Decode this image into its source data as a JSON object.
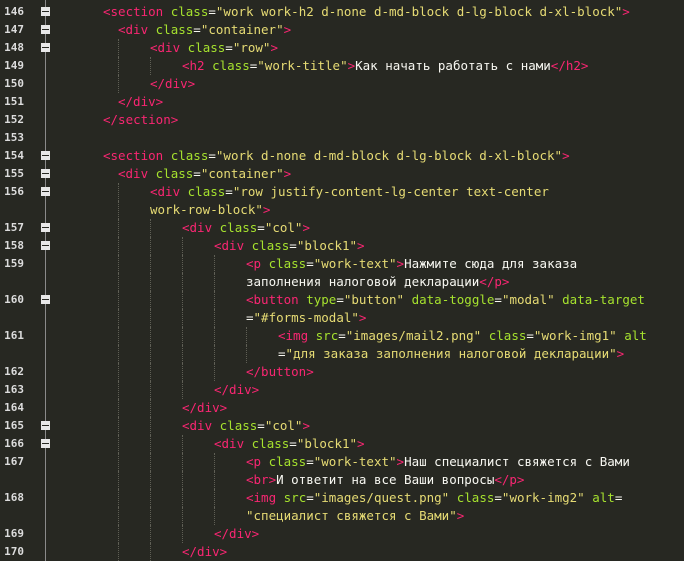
{
  "editor": {
    "theme": "monokai",
    "colors": {
      "background": "#272822",
      "tag": "#f92672",
      "attribute": "#a6e22e",
      "string": "#e6db74",
      "text": "#f8f8f2"
    },
    "rows": [
      {
        "num": "146",
        "fold": true,
        "indent": 2,
        "tokens": [
          {
            "t": "<section ",
            "c": "tg"
          },
          {
            "t": "class",
            "c": "at"
          },
          {
            "t": "=",
            "c": "tx"
          },
          {
            "t": "\"work work-h2 d-none d-md-block d-lg-block d-xl-block\"",
            "c": "st"
          },
          {
            "t": ">",
            "c": "tg"
          }
        ]
      },
      {
        "num": "147",
        "fold": true,
        "indent": 3,
        "tokens": [
          {
            "t": "<div ",
            "c": "tg"
          },
          {
            "t": "class",
            "c": "at"
          },
          {
            "t": "=",
            "c": "tx"
          },
          {
            "t": "\"container\"",
            "c": "st"
          },
          {
            "t": ">",
            "c": "tg"
          }
        ]
      },
      {
        "num": "148",
        "fold": true,
        "indent": 4,
        "tokens": [
          {
            "t": "<div ",
            "c": "tg"
          },
          {
            "t": "class",
            "c": "at"
          },
          {
            "t": "=",
            "c": "tx"
          },
          {
            "t": "\"row\"",
            "c": "st"
          },
          {
            "t": ">",
            "c": "tg"
          }
        ]
      },
      {
        "num": "149",
        "fold": false,
        "indent": 5,
        "tokens": [
          {
            "t": "<h2 ",
            "c": "tg"
          },
          {
            "t": "class",
            "c": "at"
          },
          {
            "t": "=",
            "c": "tx"
          },
          {
            "t": "\"work-title\"",
            "c": "st"
          },
          {
            "t": ">",
            "c": "tg"
          },
          {
            "t": "Как начать работать с нами",
            "c": "tx"
          },
          {
            "t": "</h2>",
            "c": "tg"
          }
        ]
      },
      {
        "num": "150",
        "fold": false,
        "indent": 4,
        "tokens": [
          {
            "t": "</div>",
            "c": "tg"
          }
        ]
      },
      {
        "num": "151",
        "fold": false,
        "indent": 3,
        "tokens": [
          {
            "t": "</div>",
            "c": "tg"
          }
        ]
      },
      {
        "num": "152",
        "fold": false,
        "indent": 2,
        "tokens": [
          {
            "t": "</section>",
            "c": "tg"
          }
        ]
      },
      {
        "num": "153",
        "fold": false,
        "indent": 2,
        "tokens": []
      },
      {
        "num": "154",
        "fold": true,
        "indent": 2,
        "tokens": [
          {
            "t": "<section ",
            "c": "tg"
          },
          {
            "t": "class",
            "c": "at"
          },
          {
            "t": "=",
            "c": "tx"
          },
          {
            "t": "\"work d-none d-md-block d-lg-block d-xl-block\"",
            "c": "st"
          },
          {
            "t": ">",
            "c": "tg"
          }
        ]
      },
      {
        "num": "155",
        "fold": true,
        "indent": 3,
        "tokens": [
          {
            "t": "<div ",
            "c": "tg"
          },
          {
            "t": "class",
            "c": "at"
          },
          {
            "t": "=",
            "c": "tx"
          },
          {
            "t": "\"container\"",
            "c": "st"
          },
          {
            "t": ">",
            "c": "tg"
          }
        ]
      },
      {
        "num": "156",
        "fold": true,
        "indent": 4,
        "tokens": [
          {
            "t": "<div ",
            "c": "tg"
          },
          {
            "t": "class",
            "c": "at"
          },
          {
            "t": "=",
            "c": "tx"
          },
          {
            "t": "\"row justify-content-lg-center text-center",
            "c": "st"
          }
        ]
      },
      {
        "num": "",
        "fold": false,
        "indent": 4,
        "tokens": [
          {
            "t": "work-row-block\"",
            "c": "st"
          },
          {
            "t": ">",
            "c": "tg"
          }
        ]
      },
      {
        "num": "157",
        "fold": true,
        "indent": 5,
        "tokens": [
          {
            "t": "<div ",
            "c": "tg"
          },
          {
            "t": "class",
            "c": "at"
          },
          {
            "t": "=",
            "c": "tx"
          },
          {
            "t": "\"col\"",
            "c": "st"
          },
          {
            "t": ">",
            "c": "tg"
          }
        ]
      },
      {
        "num": "158",
        "fold": true,
        "indent": 6,
        "tokens": [
          {
            "t": "<div ",
            "c": "tg"
          },
          {
            "t": "class",
            "c": "at"
          },
          {
            "t": "=",
            "c": "tx"
          },
          {
            "t": "\"block1\"",
            "c": "st"
          },
          {
            "t": ">",
            "c": "tg"
          }
        ]
      },
      {
        "num": "159",
        "fold": false,
        "indent": 7,
        "tokens": [
          {
            "t": "<p ",
            "c": "tg"
          },
          {
            "t": "class",
            "c": "at"
          },
          {
            "t": "=",
            "c": "tx"
          },
          {
            "t": "\"work-text\"",
            "c": "st"
          },
          {
            "t": ">",
            "c": "tg"
          },
          {
            "t": "Нажмите сюда для заказа",
            "c": "tx"
          }
        ]
      },
      {
        "num": "",
        "fold": false,
        "indent": 7,
        "tokens": [
          {
            "t": "заполнения налоговой декларации",
            "c": "tx"
          },
          {
            "t": "</p>",
            "c": "tg"
          }
        ]
      },
      {
        "num": "160",
        "fold": true,
        "indent": 7,
        "tokens": [
          {
            "t": "<button ",
            "c": "tg"
          },
          {
            "t": "type",
            "c": "at"
          },
          {
            "t": "=",
            "c": "tx"
          },
          {
            "t": "\"button\"",
            "c": "st"
          },
          {
            "t": " ",
            "c": "tx"
          },
          {
            "t": "data-toggle",
            "c": "at"
          },
          {
            "t": "=",
            "c": "tx"
          },
          {
            "t": "\"modal\"",
            "c": "st"
          },
          {
            "t": " ",
            "c": "tx"
          },
          {
            "t": "data-target",
            "c": "at"
          }
        ]
      },
      {
        "num": "",
        "fold": false,
        "indent": 7,
        "tokens": [
          {
            "t": "=",
            "c": "tx"
          },
          {
            "t": "\"#forms-modal\"",
            "c": "st"
          },
          {
            "t": ">",
            "c": "tg"
          }
        ]
      },
      {
        "num": "161",
        "fold": false,
        "indent": 8,
        "tokens": [
          {
            "t": "<img ",
            "c": "tg"
          },
          {
            "t": "src",
            "c": "at"
          },
          {
            "t": "=",
            "c": "tx"
          },
          {
            "t": "\"images/mail2.png\"",
            "c": "st"
          },
          {
            "t": " ",
            "c": "tx"
          },
          {
            "t": "class",
            "c": "at"
          },
          {
            "t": "=",
            "c": "tx"
          },
          {
            "t": "\"work-img1\"",
            "c": "st"
          },
          {
            "t": " ",
            "c": "tx"
          },
          {
            "t": "alt",
            "c": "at"
          }
        ]
      },
      {
        "num": "",
        "fold": false,
        "indent": 8,
        "tokens": [
          {
            "t": "=",
            "c": "tx"
          },
          {
            "t": "\"для заказа заполнения налоговой декларации\"",
            "c": "st"
          },
          {
            "t": ">",
            "c": "tg"
          }
        ]
      },
      {
        "num": "162",
        "fold": false,
        "indent": 7,
        "tokens": [
          {
            "t": "</button>",
            "c": "tg"
          }
        ]
      },
      {
        "num": "163",
        "fold": false,
        "indent": 6,
        "tokens": [
          {
            "t": "</div>",
            "c": "tg"
          }
        ]
      },
      {
        "num": "164",
        "fold": false,
        "indent": 5,
        "tokens": [
          {
            "t": "</div>",
            "c": "tg"
          }
        ]
      },
      {
        "num": "165",
        "fold": true,
        "indent": 5,
        "tokens": [
          {
            "t": "<div ",
            "c": "tg"
          },
          {
            "t": "class",
            "c": "at"
          },
          {
            "t": "=",
            "c": "tx"
          },
          {
            "t": "\"col\"",
            "c": "st"
          },
          {
            "t": ">",
            "c": "tg"
          }
        ]
      },
      {
        "num": "166",
        "fold": true,
        "indent": 6,
        "tokens": [
          {
            "t": "<div ",
            "c": "tg"
          },
          {
            "t": "class",
            "c": "at"
          },
          {
            "t": "=",
            "c": "tx"
          },
          {
            "t": "\"block1\"",
            "c": "st"
          },
          {
            "t": ">",
            "c": "tg"
          }
        ]
      },
      {
        "num": "167",
        "fold": false,
        "indent": 7,
        "tokens": [
          {
            "t": "<p ",
            "c": "tg"
          },
          {
            "t": "class",
            "c": "at"
          },
          {
            "t": "=",
            "c": "tx"
          },
          {
            "t": "\"work-text\"",
            "c": "st"
          },
          {
            "t": ">",
            "c": "tg"
          },
          {
            "t": "Наш специалист свяжется с Вами",
            "c": "tx"
          }
        ]
      },
      {
        "num": "",
        "fold": false,
        "indent": 7,
        "tokens": [
          {
            "t": "<br>",
            "c": "tg"
          },
          {
            "t": "И ответит на все Ваши вопросы",
            "c": "tx"
          },
          {
            "t": "</p>",
            "c": "tg"
          }
        ]
      },
      {
        "num": "168",
        "fold": false,
        "indent": 7,
        "tokens": [
          {
            "t": "<img ",
            "c": "tg"
          },
          {
            "t": "src",
            "c": "at"
          },
          {
            "t": "=",
            "c": "tx"
          },
          {
            "t": "\"images/quest.png\"",
            "c": "st"
          },
          {
            "t": " ",
            "c": "tx"
          },
          {
            "t": "class",
            "c": "at"
          },
          {
            "t": "=",
            "c": "tx"
          },
          {
            "t": "\"work-img2\"",
            "c": "st"
          },
          {
            "t": " ",
            "c": "tx"
          },
          {
            "t": "alt",
            "c": "at"
          },
          {
            "t": "=",
            "c": "tx"
          }
        ]
      },
      {
        "num": "",
        "fold": false,
        "indent": 7,
        "tokens": [
          {
            "t": "\"специалист свяжется с Вами\"",
            "c": "st"
          },
          {
            "t": ">",
            "c": "tg"
          }
        ]
      },
      {
        "num": "169",
        "fold": false,
        "indent": 6,
        "tokens": [
          {
            "t": "</div>",
            "c": "tg"
          }
        ]
      },
      {
        "num": "170",
        "fold": false,
        "indent": 5,
        "tokens": [
          {
            "t": "</div>",
            "c": "tg"
          }
        ]
      }
    ]
  }
}
